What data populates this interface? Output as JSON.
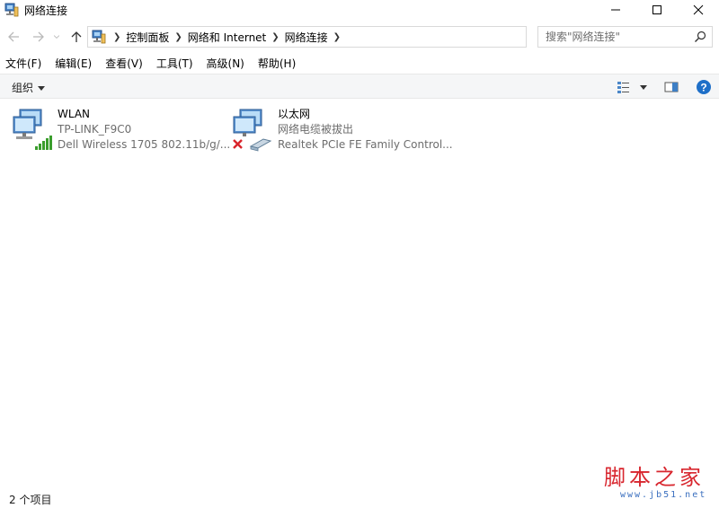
{
  "window": {
    "title": "网络连接",
    "minimize_icon": "minimize-icon",
    "maximize_icon": "maximize-icon",
    "close_icon": "close-icon"
  },
  "address": {
    "breadcrumbs": [
      "控制面板",
      "网络和 Internet",
      "网络连接"
    ],
    "search_placeholder": "搜索\"网络连接\""
  },
  "menu": [
    "文件(F)",
    "编辑(E)",
    "查看(V)",
    "工具(T)",
    "高级(N)",
    "帮助(H)"
  ],
  "command_bar": {
    "organize_label": "组织"
  },
  "connections": [
    {
      "name": "WLAN",
      "line1": "TP-LINK_F9C0",
      "line2": "Dell Wireless 1705 802.11b/g/...",
      "icon": "wifi-adapter-icon"
    },
    {
      "name": "以太网",
      "line1": "网络电缆被拔出",
      "line2": "Realtek PCIe FE Family Control...",
      "icon": "ethernet-adapter-icon"
    }
  ],
  "status": {
    "item_count": "2 个项目"
  },
  "watermark": {
    "title": "脚本之家",
    "url": "www.jb51.net"
  },
  "colors": {
    "accent": "#1e6fc8",
    "cmdbar_bg": "#f5f6f7",
    "secondary_text": "#6d6d6d",
    "error_red": "#d9242b",
    "signal_green": "#3a9d2c"
  }
}
